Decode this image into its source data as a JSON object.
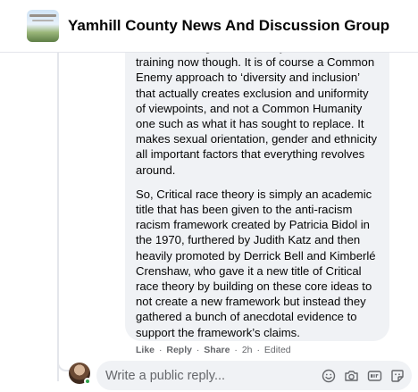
{
  "header": {
    "group_title": "Yamhill County News And Discussion Group",
    "avatar_icon": "group-cover-thumbnail-icon"
  },
  "comment": {
    "paragraphs": [
      "of what is taught as ‘diversity and inclusion’ training now though. It is of course a Common Enemy approach to ‘diversity and inclusion’ that actually creates exclusion and uniformity of viewpoints, and not a Common Humanity one such as what it has sought to replace. It makes sexual orientation, gender and ethnicity all important factors that everything revolves around.",
      "So, Critical race theory is simply an academic title that has been given to the anti-racism racism framework created by Patricia Bidol in the 1970, furthered by Judith Katz and then heavily promoted by Derrick Bell and Kimberlé Crenshaw, who gave it a new title of Critical race theory by building on these core ideas to not create a new framework but instead they gathered a bunch of anecdotal evidence to support the framework’s claims."
    ]
  },
  "actions": {
    "like": "Like",
    "reply": "Reply",
    "share": "Share",
    "separator": "·",
    "time": "2h",
    "edited": "Edited"
  },
  "composer": {
    "placeholder": "Write a public reply...",
    "icons": [
      "emoji-icon",
      "camera-icon",
      "gif-icon",
      "sticker-icon"
    ]
  },
  "colors": {
    "bubble": "#f0f2f5",
    "secondary_text": "#65676b",
    "online": "#31a24c"
  }
}
